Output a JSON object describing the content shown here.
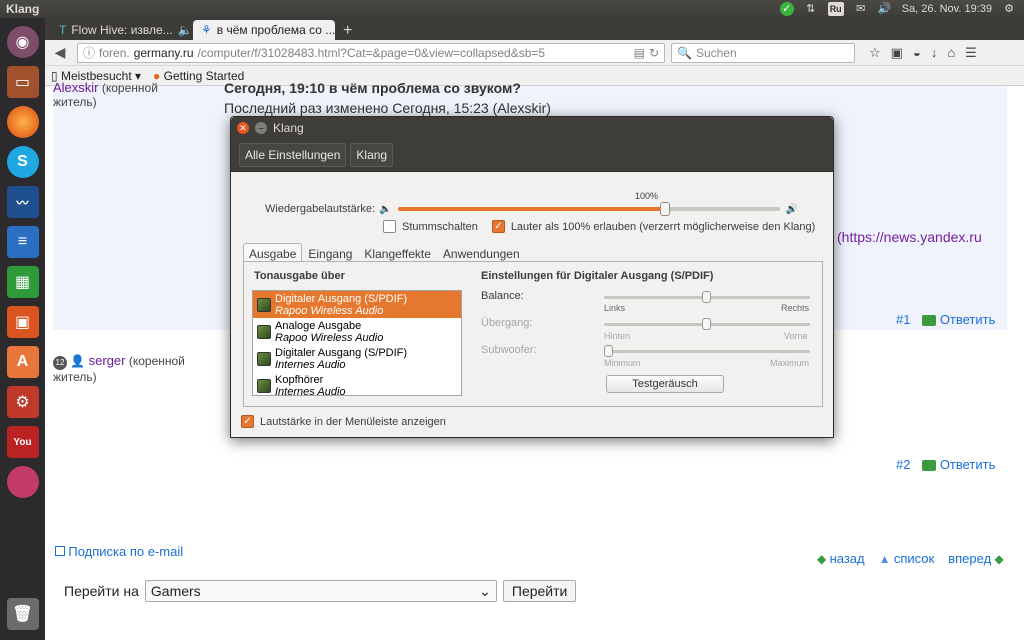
{
  "top_panel": {
    "title": "Klang",
    "keyboard": "Ru",
    "datetime": "Sa, 26. Nov. 19:39"
  },
  "launcher": {
    "items": [
      "ubuntu-dash",
      "files",
      "firefox",
      "skype",
      "system-monitor",
      "libreoffice-writer",
      "libreoffice-calc",
      "libreoffice-impress",
      "software-center",
      "system-settings",
      "youtube",
      "web-app"
    ]
  },
  "browser": {
    "tabs": [
      {
        "label": "Flow Hive: извле..."
      },
      {
        "label": "в чём проблема со ..."
      }
    ],
    "url_prefix": "foren.",
    "url_domain": "germany.ru",
    "url_path": "/computer/f/31028483.html?Cat=&page=0&view=collapsed&sb=5",
    "search_placeholder": "Suchen",
    "bookmarks": [
      "Meistbesucht",
      "Getting Started"
    ]
  },
  "forum": {
    "post1": {
      "user": "Alexskir",
      "role_line1": "(коренной",
      "role_line2": "житель)",
      "header": "Сегодня, 19:10  в чём проблема со звуком?",
      "edited": "Последний раз изменено Сегодня, 15:23 (Alexskir)",
      "link_tail": "(https://news.yandex.ru",
      "num": "#1",
      "reply": "Ответить"
    },
    "post2": {
      "rank": "12",
      "user": "serger",
      "role_line1": "(коренной",
      "role_line2": "житель)",
      "num": "#2",
      "reply": "Ответить"
    },
    "subscribe": "Подписка по e-mail",
    "nav_back": "назад",
    "nav_list": "список",
    "nav_forward": "вперед",
    "goto_label": "Перейти на",
    "goto_value": "Gamers",
    "goto_button": "Перейти"
  },
  "dialog": {
    "title": "Klang",
    "breadcrumb": [
      "Alle Einstellungen",
      "Klang"
    ],
    "volume_label": "Wiedergabelautstärke:",
    "volume_percent_label": "100%",
    "volume_value": 0.7,
    "mute_label": "Stummschalten",
    "mute_checked": false,
    "over100_label": "Lauter als 100% erlauben (verzerrt möglicherweise den Klang)",
    "over100_checked": true,
    "tabs": [
      "Ausgabe",
      "Eingang",
      "Klangeffekte",
      "Anwendungen"
    ],
    "output_heading": "Tonausgabe über",
    "devices": [
      {
        "name": "Digitaler Ausgang (S/PDIF)",
        "sub": "Rapoo Wireless Audio",
        "selected": true
      },
      {
        "name": "Analoge Ausgabe",
        "sub": "Rapoo Wireless Audio",
        "selected": false
      },
      {
        "name": "Digitaler Ausgang (S/PDIF)",
        "sub": "Internes Audio",
        "selected": false
      },
      {
        "name": "Kopfhörer",
        "sub": "Internes Audio",
        "selected": false
      }
    ],
    "settings_heading": "Einstellungen für Digitaler Ausgang (S/PDIF)",
    "balance_label": "Balance:",
    "balance_left": "Links",
    "balance_right": "Rechts",
    "fade_label": "Übergang:",
    "fade_left": "Hinten",
    "fade_right": "Vorne",
    "subwoofer_label": "Subwoofer:",
    "sub_left": "Minimum",
    "sub_right": "Maximum",
    "test_button": "Testgeräusch",
    "show_in_menu_label": "Lautstärke in der Menüleiste anzeigen",
    "show_in_menu_checked": true
  },
  "colors": {
    "accent": "#e6772e",
    "panel": "#3c3b37",
    "launcher": "#2d2a2e"
  }
}
